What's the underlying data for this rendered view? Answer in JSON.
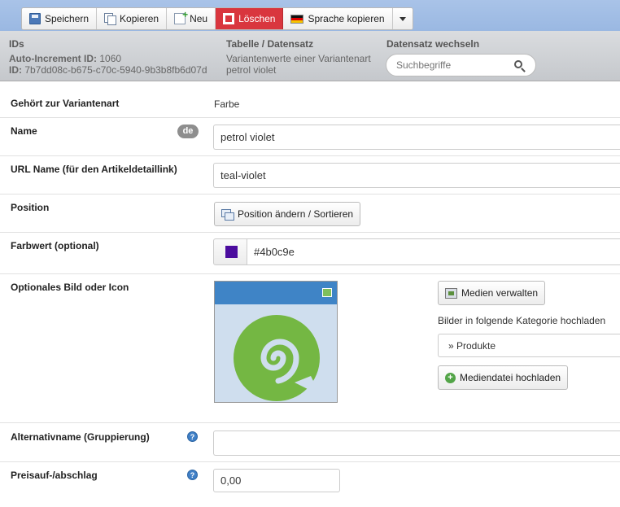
{
  "toolbar": {
    "save": "Speichern",
    "copy": "Kopieren",
    "new": "Neu",
    "delete": "Löschen",
    "copy_language": "Sprache kopieren"
  },
  "info": {
    "ids_title": "IDs",
    "auto_increment_label": "Auto-Increment ID:",
    "auto_increment_value": "1060",
    "id_label": "ID:",
    "id_value": "7b7dd08c-b675-c70c-5940-9b3b8fb6d07d",
    "table_title": "Tabelle / Datensatz",
    "table_line1": "Variantenwerte einer Variantenart",
    "table_line2": "petrol violet",
    "switch_title": "Datensatz wechseln",
    "search_placeholder": "Suchbegriffe"
  },
  "form": {
    "belongs_label": "Gehört zur Variantenart",
    "belongs_value": "Farbe",
    "name_label": "Name",
    "name_lang": "de",
    "name_value": "petrol violet",
    "url_label": "URL Name (für den Artikeldetaillink)",
    "url_value": "teal-violet",
    "position_label": "Position",
    "position_button": "Position ändern / Sortieren",
    "color_label": "Farbwert (optional)",
    "color_value": "#4b0c9e",
    "image_label": "Optionales Bild oder Icon",
    "manage_media": "Medien verwalten",
    "upload_category_text": "Bilder in folgende Kategorie hochladen",
    "category_value": "» Produkte",
    "upload_button": "Mediendatei hochladen",
    "alt_label": "Alternativname (Gruppierung)",
    "alt_value": "",
    "price_label": "Preisauf-/abschlag",
    "price_value": "0,00",
    "help_glyph": "?"
  },
  "colors": {
    "swatch": "#4b0c9e",
    "danger": "#d9363e",
    "logo_green": "#74b743"
  }
}
